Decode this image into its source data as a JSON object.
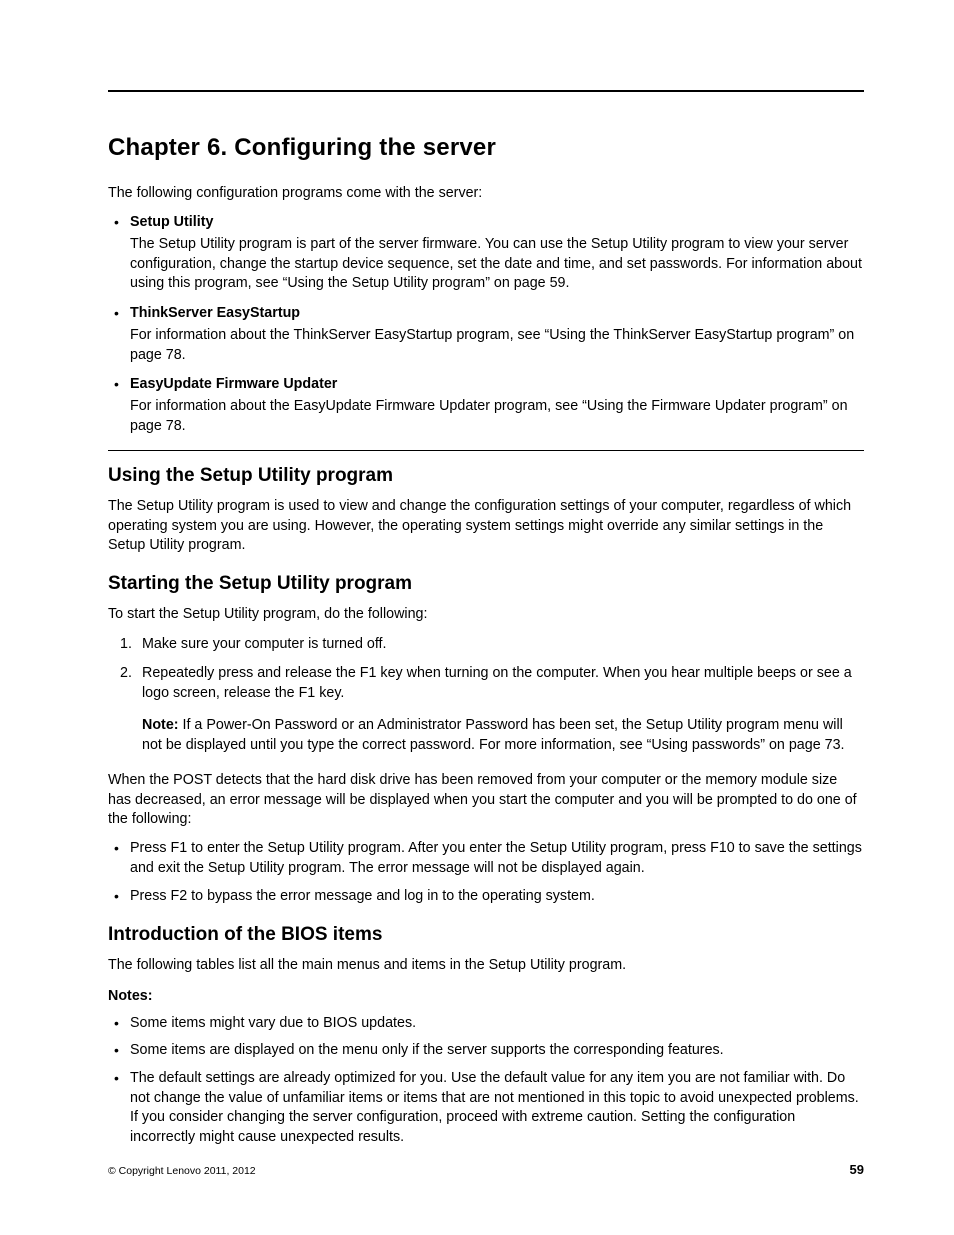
{
  "chapter": {
    "title": "Chapter 6.   Configuring the server",
    "intro": "The following configuration programs come with the server:",
    "items": [
      {
        "head": "Setup Utility",
        "body": "The Setup Utility program is part of the server firmware. You can use the Setup Utility program to view your server configuration, change the startup device sequence, set the date and time, and set passwords. For information about using this program, see “Using the Setup Utility program” on page 59."
      },
      {
        "head": "ThinkServer EasyStartup",
        "body": "For information about the ThinkServer EasyStartup program, see “Using the ThinkServer EasyStartup program” on page 78."
      },
      {
        "head": "EasyUpdate Firmware Updater",
        "body": "For information about the EasyUpdate Firmware Updater program, see “Using the Firmware Updater program” on page 78."
      }
    ]
  },
  "section_using": {
    "title": "Using the Setup Utility program",
    "body": "The Setup Utility program is used to view and change the configuration settings of your computer, regardless of which operating system you are using. However, the operating system settings might override any similar settings in the Setup Utility program."
  },
  "section_starting": {
    "title": "Starting the Setup Utility program",
    "intro": "To start the Setup Utility program, do the following:",
    "steps": [
      "Make sure your computer is turned off.",
      "Repeatedly press and release the F1 key when turning on the computer. When you hear multiple beeps or see a logo screen, release the F1 key."
    ],
    "note_label": "Note:",
    "note_body": " If a Power-On Password or an Administrator Password has been set, the Setup Utility program menu will not be displayed until you type the correct password. For more information, see “Using passwords” on page 73.",
    "post_para": "When the POST detects that the hard disk drive has been removed from your computer or the memory module size has decreased, an error message will be displayed when you start the computer and you will be prompted to do one of the following:",
    "post_bullets": [
      "Press F1 to enter the Setup Utility program. After you enter the Setup Utility program, press F10 to save the settings and exit the Setup Utility program. The error message will not be displayed again.",
      "Press F2 to bypass the error message and log in to the operating system."
    ]
  },
  "section_bios": {
    "title": "Introduction of the BIOS items",
    "intro": "The following tables list all the main menus and items in the Setup Utility program.",
    "notes_label": "Notes:",
    "notes": [
      "Some items might vary due to BIOS updates.",
      "Some items are displayed on the menu only if the server supports the corresponding features.",
      "The default settings are already optimized for you. Use the default value for any item you are not familiar with. Do not change the value of unfamiliar items or items that are not mentioned in this topic to avoid unexpected problems. If you consider changing the server configuration, proceed with extreme caution. Setting the configuration incorrectly might cause unexpected results."
    ]
  },
  "footer": {
    "copyright": "© Copyright Lenovo 2011, 2012",
    "page": "59"
  }
}
